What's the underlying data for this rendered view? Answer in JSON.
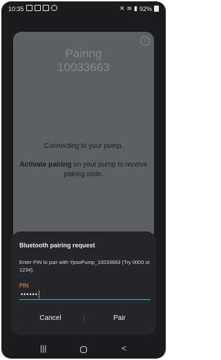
{
  "status_bar": {
    "time": "10:35",
    "battery_text": "92%",
    "notification_icons": [
      "mail-icon",
      "app-icon",
      "image-icon",
      "search-icon"
    ],
    "system_icons": [
      "mute-icon",
      "wifi-icon",
      "signal-icon",
      "battery-icon"
    ]
  },
  "app": {
    "title_line1": "Pairing",
    "title_line2": "10033663",
    "connecting_text": "Connecting to your pump.",
    "activate_bold": "Activate pairing",
    "activate_rest": " on your pump to receive pairing code."
  },
  "dialog": {
    "title": "Bluetooth pairing request",
    "message": "Enter PIN to pair with YpsoPump_10033663 (Try 0000 or 1234).",
    "pin_label": "PIN",
    "pin_value": "••••••",
    "cancel_label": "Cancel",
    "pair_label": "Pair",
    "accent_color": "#3bb8d8",
    "label_color": "#f19a4f"
  },
  "nav_bar": {
    "recent_glyph": "|||",
    "back_glyph": "<"
  }
}
